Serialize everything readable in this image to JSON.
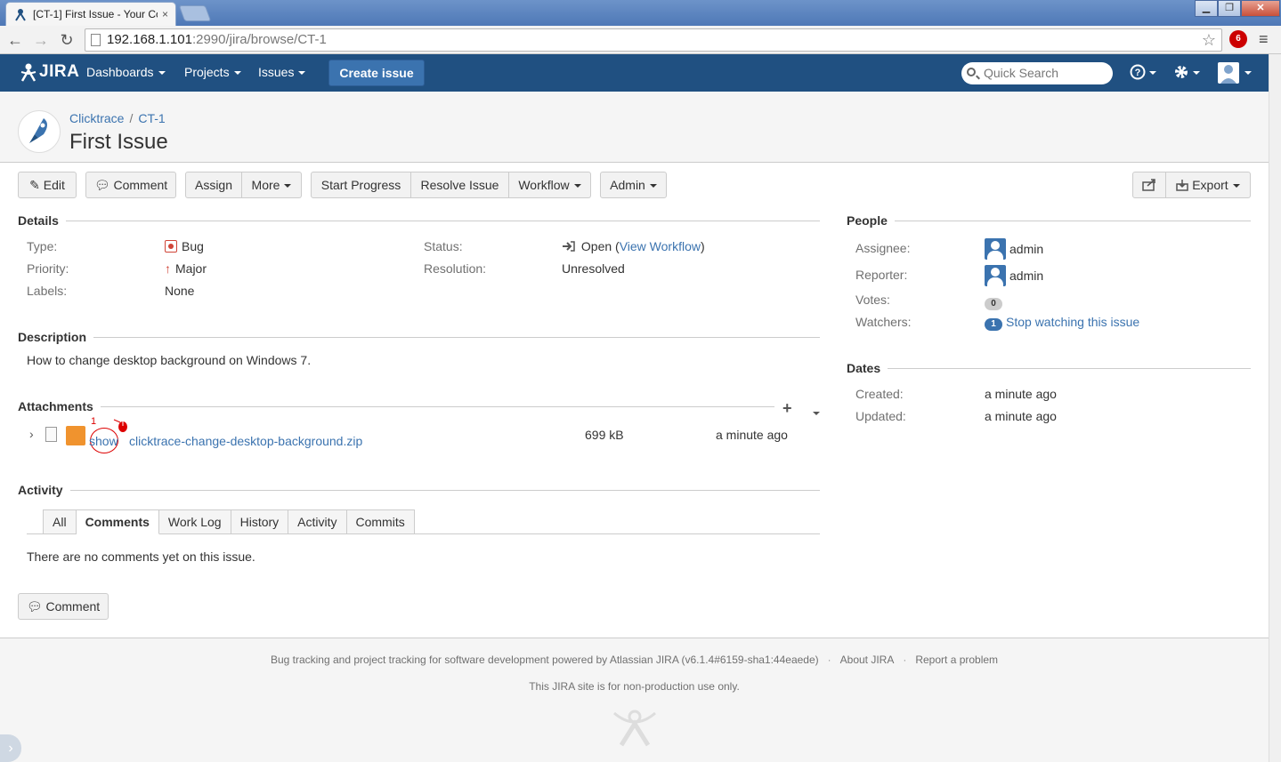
{
  "browser": {
    "tab_title": "[CT-1] First Issue - Your Co",
    "tab_close": "×",
    "url_host": "192.168.1.101",
    "url_rest": ":2990/jira/browse/CT-1",
    "ext_badge": "6",
    "window_min": "▁",
    "window_max": "❐",
    "window_close": "✕"
  },
  "header": {
    "logo": "JIRA",
    "nav": [
      "Dashboards",
      "Projects",
      "Issues"
    ],
    "create_label": "Create issue",
    "search_placeholder": "Quick Search"
  },
  "issue": {
    "project": "Clicktrace",
    "key": "CT-1",
    "title": "First Issue"
  },
  "ops": {
    "edit": "Edit",
    "comment": "Comment",
    "assign": "Assign",
    "more": "More",
    "start_progress": "Start Progress",
    "resolve": "Resolve Issue",
    "workflow": "Workflow",
    "admin": "Admin",
    "export": "Export"
  },
  "details": {
    "heading": "Details",
    "type_label": "Type:",
    "type_value": "Bug",
    "priority_label": "Priority:",
    "priority_value": "Major",
    "labels_label": "Labels:",
    "labels_value": "None",
    "status_label": "Status:",
    "status_value": "Open",
    "view_workflow": "View Workflow",
    "resolution_label": "Resolution:",
    "resolution_value": "Unresolved"
  },
  "description": {
    "heading": "Description",
    "text": "How to change desktop background on Windows 7."
  },
  "attachments": {
    "heading": "Attachments",
    "annotation_number": "1",
    "show": "show",
    "file_name": "clicktrace-change-desktop-background.zip",
    "file_size": "699 kB",
    "file_date": "a minute ago"
  },
  "activity": {
    "heading": "Activity",
    "tabs": [
      "All",
      "Comments",
      "Work Log",
      "History",
      "Activity",
      "Commits"
    ],
    "empty_text": "There are no comments yet on this issue.",
    "comment_button": "Comment"
  },
  "people": {
    "heading": "People",
    "assignee_label": "Assignee:",
    "assignee": "admin",
    "reporter_label": "Reporter:",
    "reporter": "admin",
    "votes_label": "Votes:",
    "votes": "0",
    "watchers_label": "Watchers:",
    "watchers": "1",
    "stop_watching": "Stop watching this issue"
  },
  "dates": {
    "heading": "Dates",
    "created_label": "Created:",
    "created": "a minute ago",
    "updated_label": "Updated:",
    "updated": "a minute ago"
  },
  "footer": {
    "powered": "Bug tracking and project tracking for software development powered by Atlassian JIRA (v6.1.4#6159-sha1:44eaede)",
    "about": "About JIRA",
    "report": "Report a problem",
    "notice": "This JIRA site is for non-production use only."
  },
  "colors": {
    "header_bg": "#205081",
    "link": "#3b73af",
    "create_button": "#3b73af"
  }
}
